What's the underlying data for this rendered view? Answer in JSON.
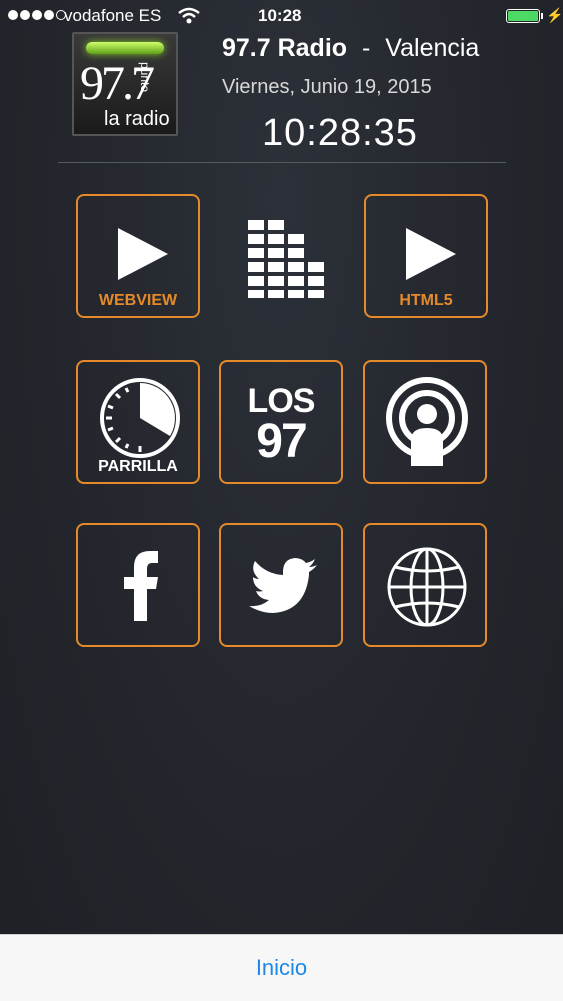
{
  "status_bar": {
    "carrier": "vodafone ES",
    "time": "10:28",
    "bolt": "⚡"
  },
  "header": {
    "logo": {
      "freq": "97.7",
      "punto": "punto",
      "tagline": "la radio"
    },
    "station_name": "97.7 Radio",
    "separator": "-",
    "city": "Valencia",
    "date": "Viernes, Junio 19, 2015",
    "clock": "10:28:35"
  },
  "tiles": {
    "webview": {
      "label": "WEBVIEW"
    },
    "html5": {
      "label": "HTML5"
    },
    "parrilla": {
      "label": "PARRILLA"
    },
    "los97": {
      "line1": "LOS",
      "line2": "97"
    }
  },
  "bottom_bar": {
    "label": "Inicio"
  },
  "colors": {
    "accent": "#e58a2a",
    "link": "#1e88e5",
    "battery": "#4cd964"
  }
}
